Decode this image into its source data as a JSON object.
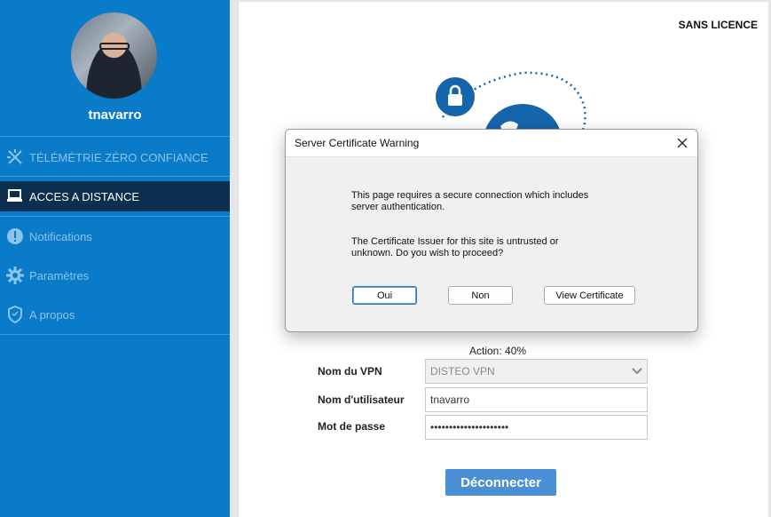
{
  "user": {
    "name": "tnavarro"
  },
  "sidebar": {
    "items": [
      {
        "label": "TÉLÉMÉTRIE ZÉRO CONFIANCE",
        "icon": "telemetry-icon",
        "active": false
      },
      {
        "label": "ACCES A DISTANCE",
        "icon": "remote-access-icon",
        "active": true
      },
      {
        "label": "Notifications",
        "icon": "notification-icon",
        "active": false
      },
      {
        "label": "Paramètres",
        "icon": "gear-icon",
        "active": false
      },
      {
        "label": "A propos",
        "icon": "shield-icon",
        "active": false
      }
    ]
  },
  "main": {
    "license": "SANS LICENCE",
    "progress": "Action: 40%",
    "vpn_label": "Nom du VPN",
    "vpn_value": "DISTEO VPN",
    "user_label": "Nom d'utilisateur",
    "user_value": "tnavarro",
    "password_label": "Mot de passe",
    "password_value": "•••••••••••••••••••••",
    "disconnect_label": "Déconnecter"
  },
  "dialog": {
    "title": "Server Certificate Warning",
    "line1": "This page requires a secure connection which includes",
    "line2": "server authentication.",
    "line3": "The Certificate Issuer for this site is untrusted or",
    "line4": "unknown. Do you wish to proceed?",
    "btn_yes": "Oui",
    "btn_no": "Non",
    "btn_view": "View Certificate"
  },
  "colors": {
    "sidebar": "#0a7bc9",
    "active": "#0c2e4f",
    "accent": "#1565ad",
    "button": "#4b8fd6"
  }
}
